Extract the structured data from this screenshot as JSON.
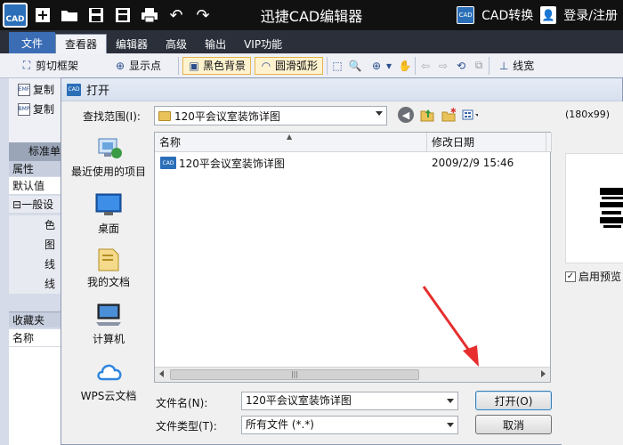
{
  "app": {
    "title": "迅捷CAD编辑器",
    "logo_text": "CAD",
    "convert_label": "CAD转换",
    "convert_icon_text": "CAD",
    "login_label": "登录/注册"
  },
  "menu": {
    "file": "文件",
    "tabs": [
      "查看器",
      "编辑器",
      "高级",
      "输出",
      "VIP功能"
    ]
  },
  "ribbon": {
    "items": [
      "剪切框架",
      "显示点",
      "黑色背景",
      "圆滑弧形",
      "线宽"
    ]
  },
  "left_ribbon": {
    "items": [
      "复制",
      "复制"
    ],
    "icons": [
      "EMF",
      "BMP"
    ]
  },
  "left_panel": {
    "standard": "标准单",
    "properties": "属性",
    "default": "默认值",
    "general": "一般设",
    "subs": [
      "色",
      "图",
      "线",
      "线"
    ],
    "favorites": "收藏夹",
    "name": "名称"
  },
  "dialog": {
    "title": "打开",
    "title_icon_text": "CAD",
    "look_in_label": "查找范围(I):",
    "look_in_value": "120平会议室装饰详图",
    "places": [
      "最近使用的项目",
      "桌面",
      "我的文档",
      "计算机",
      "WPS云文档"
    ],
    "columns": [
      "名称",
      "修改日期"
    ],
    "files": [
      {
        "name": "120平会议室装饰详图",
        "date": "2009/2/9 15:46",
        "icon_text": "CAD"
      }
    ],
    "file_name_label": "文件名(N):",
    "file_name_value": "120平会议室装饰详图",
    "file_type_label": "文件类型(T):",
    "file_type_value": "所有文件 (*.*)",
    "open_button": "打开(O)",
    "cancel_button": "取消",
    "preview_size": "(180x99)",
    "enable_preview": "启用预览"
  }
}
